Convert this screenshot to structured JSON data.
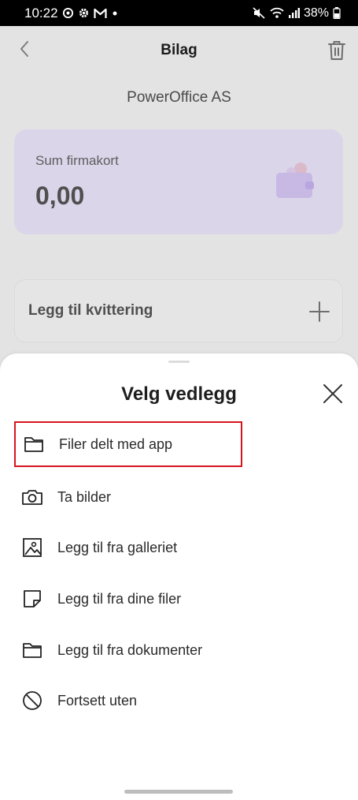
{
  "status_bar": {
    "time": "10:22",
    "battery": "38%",
    "left_icons": [
      "whatsapp-icon",
      "settings-icon",
      "gmail-icon",
      "dot-icon"
    ],
    "right_icons": [
      "mute-icon",
      "wifi-icon",
      "signal-icon",
      "battery-icon"
    ]
  },
  "app_bar": {
    "title": "Bilag",
    "back_icon": "chevron-left-icon",
    "delete_icon": "trash-icon"
  },
  "company": "PowerOffice AS",
  "card": {
    "label": "Sum firmakort",
    "value": "0,00",
    "icon": "wallet-icon"
  },
  "receipt": {
    "label": "Legg til kvittering",
    "icon": "plus-icon"
  },
  "sheet": {
    "title": "Velg vedlegg",
    "close_icon": "close-icon",
    "options": [
      {
        "label": "Filer delt med app",
        "icon": "folder-icon",
        "highlighted": true
      },
      {
        "label": "Ta bilder",
        "icon": "camera-icon"
      },
      {
        "label": "Legg til fra galleriet",
        "icon": "gallery-icon"
      },
      {
        "label": "Legg til fra dine filer",
        "icon": "file-icon"
      },
      {
        "label": "Legg til fra dokumenter",
        "icon": "folder-icon"
      },
      {
        "label": "Fortsett uten",
        "icon": "block-icon"
      }
    ]
  },
  "colors": {
    "card_bg": "#ece6fb",
    "wallet_accent": "#d8c8f6",
    "highlight_border": "#d9141e",
    "text_dark": "#1e1e1e"
  }
}
